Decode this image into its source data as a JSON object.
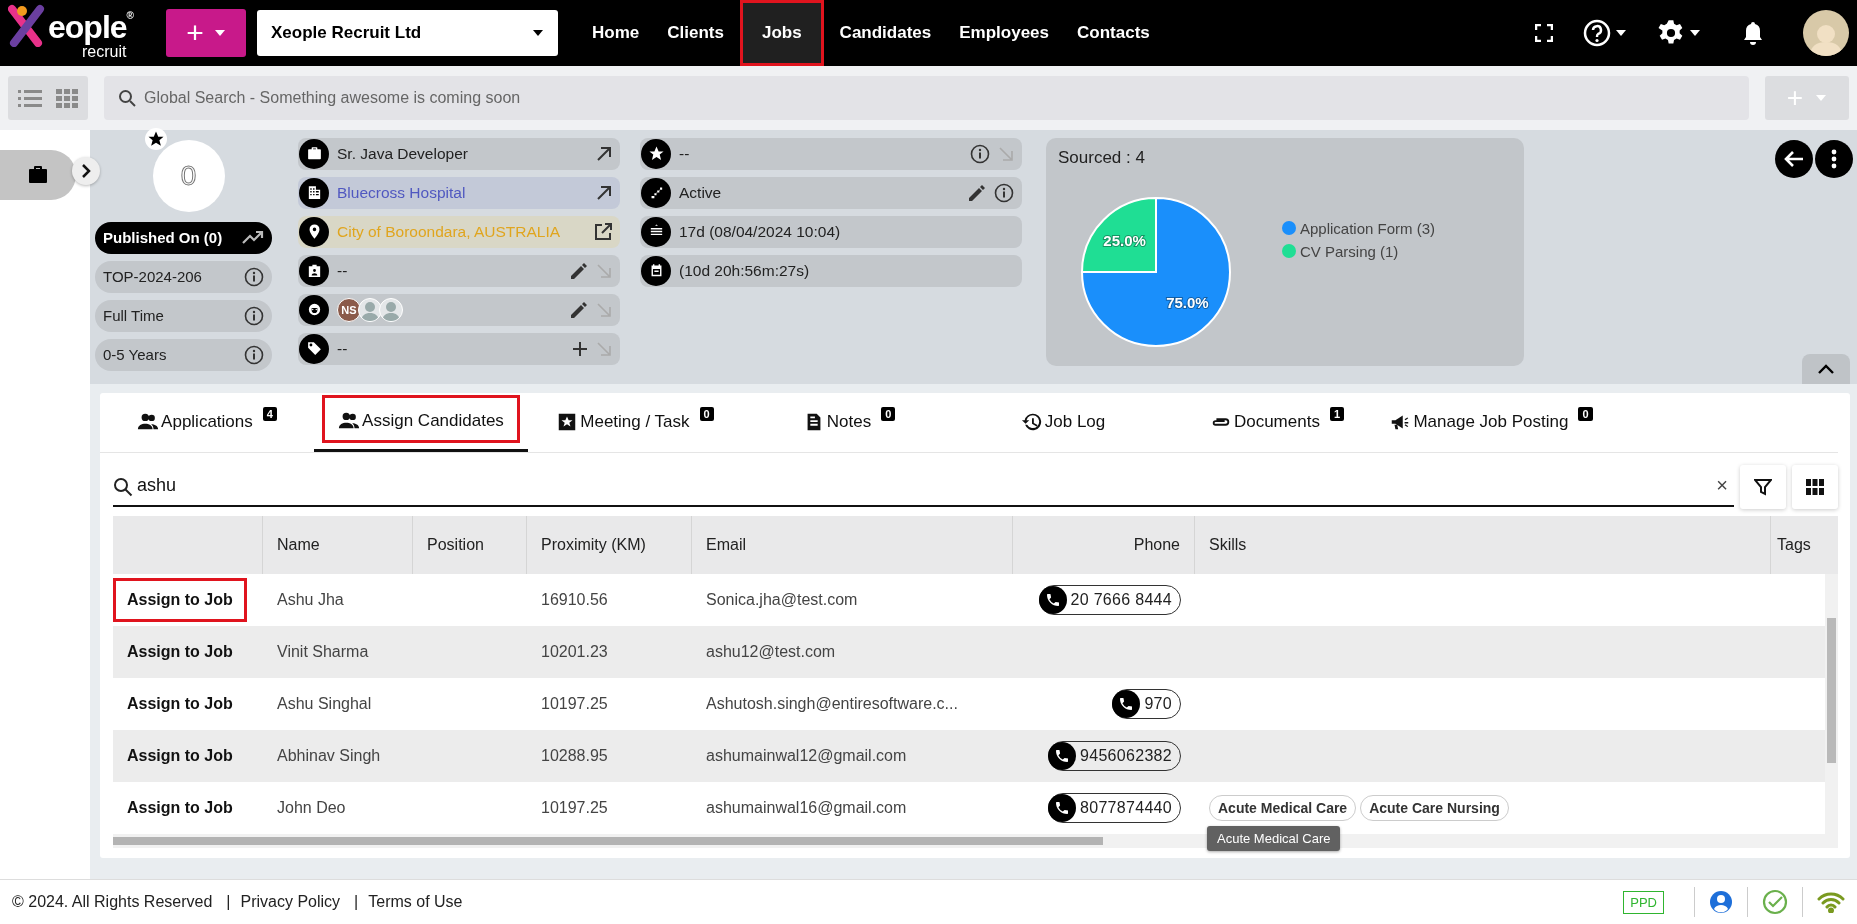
{
  "header": {
    "logo": {
      "word": "eople$^{®}$",
      "sub": "recruit"
    },
    "add_button": {
      "label": "+"
    },
    "company": "Xeople Recruit Ltd",
    "nav": [
      {
        "label": "Home",
        "selected": false,
        "highlighted": false
      },
      {
        "label": "Clients",
        "selected": false,
        "highlighted": false
      },
      {
        "label": "Jobs",
        "selected": true,
        "highlighted": true
      },
      {
        "label": "Candidates",
        "selected": false,
        "highlighted": false
      },
      {
        "label": "Employees",
        "selected": false,
        "highlighted": false
      },
      {
        "label": "Contacts",
        "selected": false,
        "highlighted": false
      }
    ]
  },
  "toolbar": {
    "search": {
      "placeholder": "Global Search - Something awesome is coming soon"
    },
    "add_button": {
      "label": "+",
      "disabled": true
    }
  },
  "job": {
    "score": "0",
    "pills": [
      {
        "kind": "dark",
        "label": "Published On (0)"
      },
      {
        "kind": "info",
        "label": "TOP-2024-206"
      },
      {
        "kind": "info",
        "label": "Full Time"
      },
      {
        "kind": "info",
        "label": "0-5 Years"
      }
    ],
    "fields_left": [
      {
        "kind": "title",
        "value": "Sr. Java Developer"
      },
      {
        "kind": "client",
        "value": "Bluecross Hospital"
      },
      {
        "kind": "location",
        "value": "City of Boroondara, AUSTRALIA"
      },
      {
        "kind": "contact",
        "value": "--"
      },
      {
        "kind": "team",
        "members": [
          {
            "kind": "initials",
            "text": "NS"
          },
          {
            "kind": "photo"
          },
          {
            "kind": "photo"
          }
        ]
      },
      {
        "kind": "tags",
        "value": "--"
      }
    ],
    "fields_right": [
      {
        "kind": "rating",
        "value": "--"
      },
      {
        "kind": "status",
        "value": "Active"
      },
      {
        "kind": "age",
        "value": "17d (08/04/2024 10:04)"
      },
      {
        "kind": "countdown",
        "value": "(10d 20h:56m:27s)"
      }
    ],
    "chart": {
      "slices": [
        {
          "color": "#1a8ffb"
        },
        {
          "color": "#1fde94"
        }
      ],
      "chart_data": {
        "type": "pie",
        "title": "Sourced : 4",
        "categories": [
          "Application Form (3)",
          "CV Parsing (1)"
        ],
        "values": [
          75,
          25
        ],
        "legend": "right",
        "value_labels": [
          "75.0%",
          "25.0%"
        ]
      }
    }
  },
  "tabs": [
    {
      "kind": "people",
      "label": "Applications",
      "count": "4",
      "selected": false,
      "highlighted": false
    },
    {
      "kind": "people",
      "label": "Assign Candidates",
      "selected": true,
      "highlighted": true
    },
    {
      "kind": "star",
      "label": "Meeting / Task",
      "count": "0",
      "selected": false,
      "highlighted": false
    },
    {
      "kind": "note",
      "label": "Notes",
      "count": "0",
      "selected": false,
      "highlighted": false
    },
    {
      "kind": "history",
      "label": "Job Log",
      "selected": false,
      "highlighted": false
    },
    {
      "kind": "clip",
      "label": "Documents",
      "count": "1",
      "selected": false,
      "highlighted": false
    },
    {
      "kind": "megaphone",
      "label": "Manage Job Posting",
      "count": "0",
      "selected": false,
      "highlighted": false
    }
  ],
  "filter": {
    "value": "ashu",
    "clear": "×"
  },
  "table": {
    "columns": [
      "Name",
      "Position",
      "Proximity (KM)",
      "Email",
      "Phone",
      "Skills",
      "Tags"
    ],
    "rows": [
      {
        "action": "Assign to Job",
        "highlighted": true,
        "name": "Ashu Jha",
        "proximity": "16910.56",
        "email": "Sonica.jha@test.com",
        "phone": "20 7666 8444"
      },
      {
        "action": "Assign to Job",
        "highlighted": false,
        "name": "Vinit Sharma",
        "proximity": "10201.23",
        "email": "ashu12@test.com"
      },
      {
        "action": "Assign to Job",
        "highlighted": false,
        "name": "Ashu Singhal",
        "proximity": "10197.25",
        "email": "Ashutosh.singh@entiresoftware.c...",
        "phone": "970"
      },
      {
        "action": "Assign to Job",
        "highlighted": false,
        "name": "Abhinav Singh",
        "proximity": "10288.95",
        "email": "ashumainwal12@gmail.com",
        "phone": "9456062382"
      },
      {
        "action": "Assign to Job",
        "highlighted": false,
        "name": "John Deo",
        "proximity": "10197.25",
        "email": "ashumainwal16@gmail.com",
        "phone": "8077874440",
        "skills": [
          "Acute Medical Care",
          "Acute Care Nursing"
        ],
        "tooltip": "Acute Medical Care"
      }
    ]
  },
  "footer": {
    "copyright": "© 2024. All Rights Reserved",
    "links": [
      {
        "separator": "|",
        "label": "Privacy Policy"
      },
      {
        "separator": "|",
        "label": "Terms of Use"
      }
    ],
    "badge": "PPD"
  }
}
